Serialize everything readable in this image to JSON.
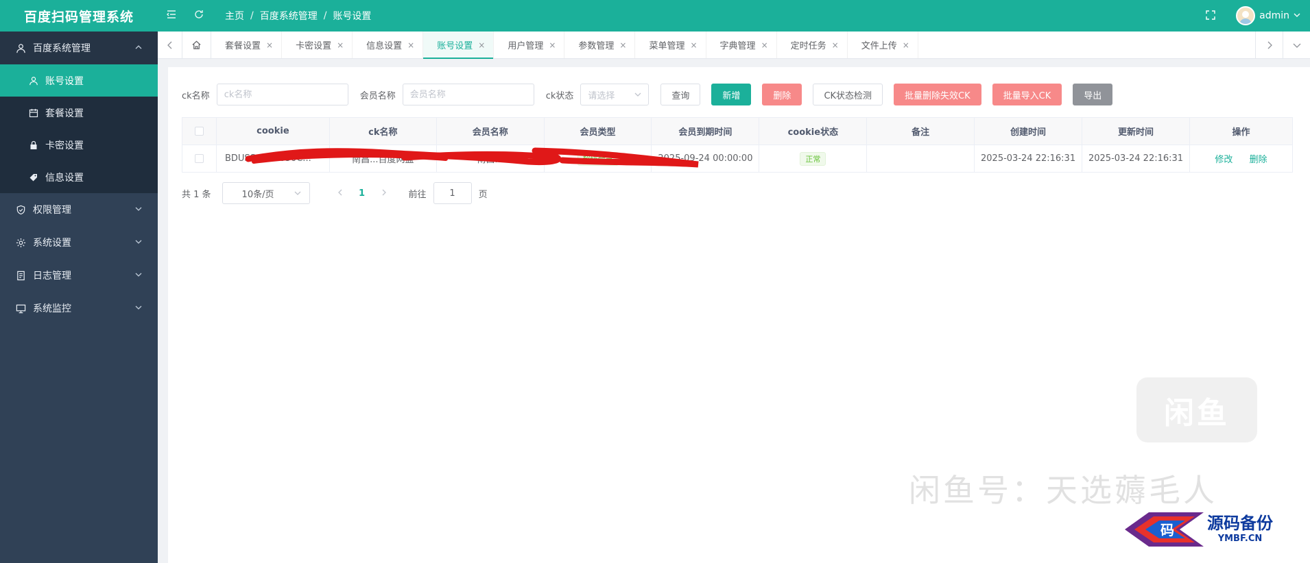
{
  "app": {
    "title": "百度扫码管理系统"
  },
  "header": {
    "breadcrumb": [
      "主页",
      "百度系统管理",
      "账号设置"
    ],
    "separator": "/",
    "user": "admin"
  },
  "sidebar": {
    "groups": [
      {
        "label": "百度系统管理",
        "icon": "user-icon",
        "expanded": true,
        "children": [
          {
            "label": "账号设置",
            "icon": "user-icon",
            "active": true
          },
          {
            "label": "套餐设置",
            "icon": "calendar-icon",
            "active": false
          },
          {
            "label": "卡密设置",
            "icon": "lock-icon",
            "active": false
          },
          {
            "label": "信息设置",
            "icon": "tag-icon",
            "active": false
          }
        ]
      },
      {
        "label": "权限管理",
        "icon": "shield-icon",
        "expanded": false
      },
      {
        "label": "系统设置",
        "icon": "gear-icon",
        "expanded": false
      },
      {
        "label": "日志管理",
        "icon": "document-icon",
        "expanded": false
      },
      {
        "label": "系统监控",
        "icon": "monitor-icon",
        "expanded": false
      }
    ]
  },
  "tabs": {
    "items": [
      {
        "label": "套餐设置",
        "active": false
      },
      {
        "label": "卡密设置",
        "active": false
      },
      {
        "label": "信息设置",
        "active": false
      },
      {
        "label": "账号设置",
        "active": true
      },
      {
        "label": "用户管理",
        "active": false
      },
      {
        "label": "参数管理",
        "active": false
      },
      {
        "label": "菜单管理",
        "active": false
      },
      {
        "label": "字典管理",
        "active": false
      },
      {
        "label": "定时任务",
        "active": false
      },
      {
        "label": "文件上传",
        "active": false
      }
    ],
    "close_glyph": "×"
  },
  "filters": {
    "ck_name_label": "ck名称",
    "ck_name_placeholder": "ck名称",
    "member_name_label": "会员名称",
    "member_name_placeholder": "会员名称",
    "ck_status_label": "ck状态",
    "ck_status_placeholder": "请选择"
  },
  "buttons": {
    "query": "查询",
    "add": "新增",
    "delete": "删除",
    "check_status": "CK状态检测",
    "batch_delete_invalid": "批量删除失效CK",
    "batch_import": "批量导入CK",
    "export": "导出"
  },
  "table": {
    "columns": [
      "cookie",
      "ck名称",
      "会员名称",
      "会员类型",
      "会员到期时间",
      "cookie状态",
      "备注",
      "创建时间",
      "更新时间",
      "操作"
    ],
    "rows": [
      {
        "cookie": "BDUSS=LFB650C...",
        "ck_name": "南昌...百度网盘",
        "member_name": "南昌...",
        "member_type": "超级会员",
        "expire_time": "2025-09-24 00:00:00",
        "cookie_status": "正常",
        "remark": "",
        "created_at": "2025-03-24 22:16:31",
        "updated_at": "2025-03-24 22:16:31",
        "actions": {
          "edit": "修改",
          "delete": "删除"
        }
      }
    ]
  },
  "pagination": {
    "total_text": "共 1 条",
    "page_size": "10条/页",
    "current_page": "1",
    "goto_label": "前往",
    "goto_value": "1",
    "page_suffix": "页"
  },
  "watermarks": {
    "box_text": "闲鱼",
    "seller_text": "闲鱼号：天选薅毛人",
    "logo_badge": "码",
    "logo_cn": "源码备份",
    "logo_en": "YMBF.CN"
  },
  "colors": {
    "accent": "#1bb09a",
    "sidebar_bg": "#304156",
    "danger": "#f56c6c",
    "gray_button": "#909399",
    "redaction": "#e01818"
  }
}
